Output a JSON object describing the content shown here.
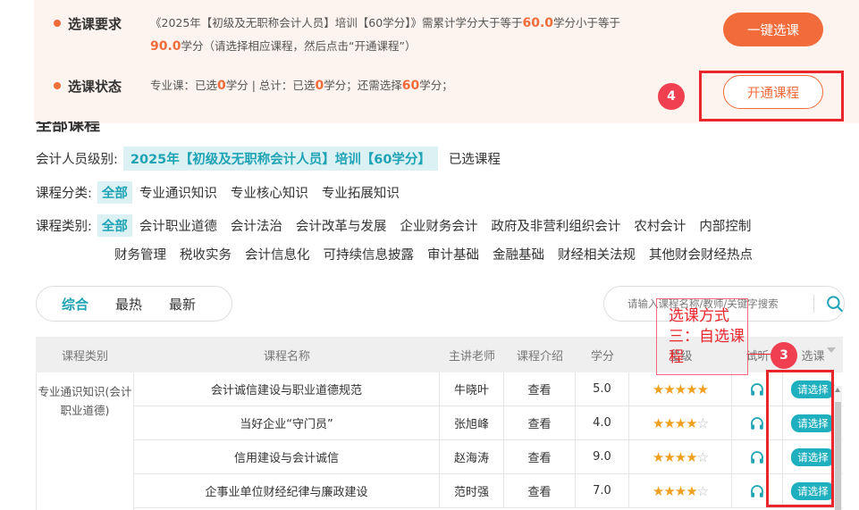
{
  "requirement": {
    "label": "选课要求",
    "text_prefix": "《2025年【初级及无职称会计人员】培训【60学分】》需累计学分大于等于",
    "min_credit": "60.0",
    "text_mid": "学分小于等于",
    "max_credit": "90.0",
    "text_suffix": "学分（请选择相应课程，然后点击“开通课程”）",
    "one_click_button": "一键选课"
  },
  "status": {
    "label": "选课状态",
    "text1": "专业课：已选",
    "pro_selected": "0",
    "text2": "学分 | 总计：已选",
    "total_selected": "0",
    "text3": "学分；还需选择",
    "remaining": "60",
    "text4": "学分；",
    "open_button": "开通课程"
  },
  "cut_heading": "全部课程",
  "filters": {
    "level_label": "会计人员级别:",
    "level_selected": "2025年【初级及无职称会计人员】培训【60学分】",
    "level_other": "已选课程",
    "category_label": "课程分类:",
    "category_all": "全部",
    "categories": [
      "专业通识知识",
      "专业核心知识",
      "专业拓展知识"
    ],
    "type_label": "课程类别:",
    "type_all": "全部",
    "types_line1": [
      "会计职业道德",
      "会计法治",
      "会计改革与发展",
      "企业财务会计",
      "政府及非营利组织会计",
      "农村会计",
      "内部控制"
    ],
    "types_line2": [
      "财务管理",
      "税收实务",
      "会计信息化",
      "可持续信息披露",
      "审计基础",
      "金融基础",
      "财经相关法规",
      "其他财会财经热点"
    ]
  },
  "sort_tabs": [
    "综合",
    "最热",
    "最新"
  ],
  "search": {
    "placeholder": "请输入课程名称/教师/关键字搜索"
  },
  "annotation": {
    "text": "选课方式三：自选课程",
    "step3": "3",
    "step4": "4"
  },
  "table": {
    "headers": [
      "课程类别",
      "课程名称",
      "主讲老师",
      "课程介绍",
      "学分",
      "星级",
      "试听",
      "选课"
    ],
    "category_cell": "专业通识知识(会计职业道德)",
    "rows": [
      {
        "name": "会计诚信建设与职业道德规范",
        "teacher": "牛晓叶",
        "intro": "查看",
        "credit": "5.0",
        "stars": 5,
        "select": "请选择"
      },
      {
        "name": "当好企业“守门员”",
        "teacher": "张旭峰",
        "intro": "查看",
        "credit": "4.0",
        "stars": 4,
        "select": "请选择"
      },
      {
        "name": "信用建设与会计诚信",
        "teacher": "赵海涛",
        "intro": "查看",
        "credit": "9.0",
        "stars": 4,
        "select": "请选择"
      },
      {
        "name": "企事业单位财经纪律与廉政建设",
        "teacher": "范时强",
        "intro": "查看",
        "credit": "7.0",
        "stars": 4,
        "select": "请选择"
      }
    ]
  },
  "colors": {
    "accent_orange": "#f26b3a",
    "teal": "#1fb0c0",
    "highlight_red": "#e8262c",
    "star": "#f0a020"
  }
}
